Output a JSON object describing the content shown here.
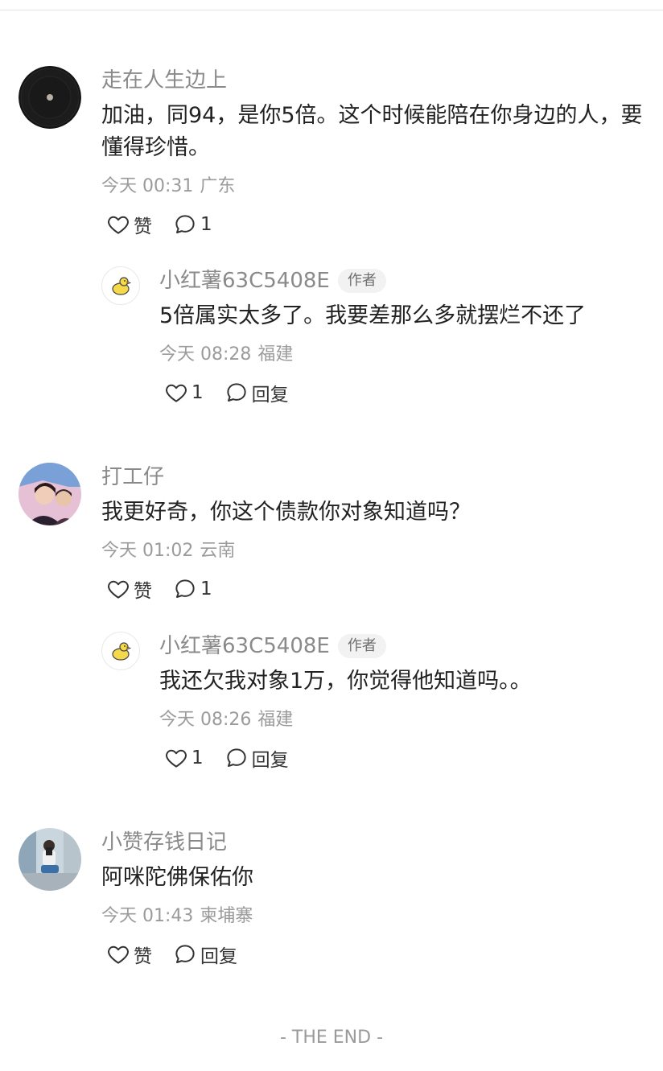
{
  "comments": [
    {
      "author": "走在人生边上",
      "text": "加油，同94，是你5倍。这个时候能陪在你身边的人，要懂得珍惜。",
      "time": "今天 00:31",
      "location": "广东",
      "like_label": "赞",
      "reply_count": "1",
      "reply": {
        "author": "小红薯63C5408E",
        "badge": "作者",
        "text": "5倍属实太多了。我要差那么多就摆烂不还了",
        "time": "今天 08:28",
        "location": "福建",
        "like_count": "1",
        "reply_label": "回复"
      }
    },
    {
      "author": "打工仔",
      "text": "我更好奇，你这个债款你对象知道吗？",
      "time": "今天 01:02",
      "location": "云南",
      "like_label": "赞",
      "reply_count": "1",
      "reply": {
        "author": "小红薯63C5408E",
        "badge": "作者",
        "text": "我还欠我对象1万，你觉得他知道吗。。",
        "time": "今天 08:26",
        "location": "福建",
        "like_count": "1",
        "reply_label": "回复"
      }
    },
    {
      "author": "小赞存钱日记",
      "text": "阿咪陀佛保佑你",
      "time": "今天 01:43",
      "location": "柬埔寨",
      "like_label": "赞",
      "reply_label": "回复"
    }
  ],
  "footer": {
    "end_text": "- THE END -"
  },
  "icons": {
    "like": "heart-outline-icon",
    "comment": "speech-bubble-icon"
  },
  "colors": {
    "author": "#8a8a8a",
    "text": "#222222",
    "meta": "#9b9b9b",
    "badge_bg": "#f2f2f2"
  }
}
